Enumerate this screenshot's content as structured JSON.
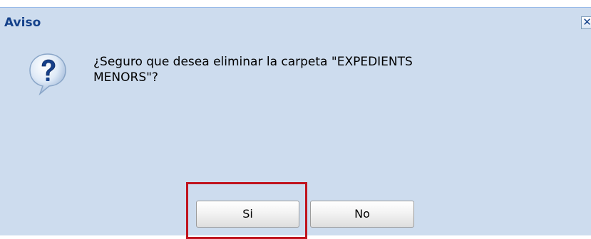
{
  "dialog": {
    "title": "Aviso",
    "close_label": "✕",
    "message_line1": "¿Seguro que desea eliminar la carpeta \"EXPEDIENTS",
    "message_line2": "MENORS\"?",
    "icon": "question-icon"
  },
  "buttons": {
    "yes_label": "Si",
    "no_label": "No"
  },
  "colors": {
    "dialog_background": "#cddcee",
    "title_text": "#15428b",
    "highlight_border": "#c0141e"
  }
}
